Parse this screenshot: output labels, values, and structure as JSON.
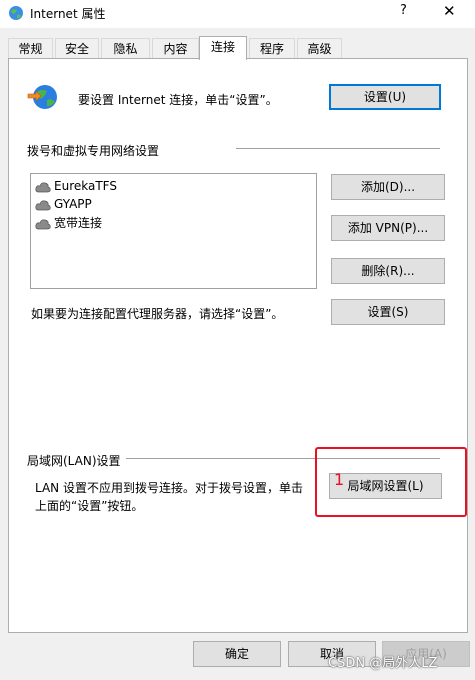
{
  "window": {
    "title": "Internet 属性",
    "help_label": "?",
    "close_label": "✕"
  },
  "tabs": [
    {
      "label": "常规"
    },
    {
      "label": "安全"
    },
    {
      "label": "隐私"
    },
    {
      "label": "内容"
    },
    {
      "label": "连接",
      "active": true
    },
    {
      "label": "程序"
    },
    {
      "label": "高级"
    }
  ],
  "setup": {
    "text": "要设置 Internet 连接，单击“设置”。",
    "button": "设置(U)"
  },
  "dialup": {
    "heading": "拨号和虚拟专用网络设置",
    "items": [
      {
        "label": "EurekaTFS"
      },
      {
        "label": "GYAPP"
      },
      {
        "label": "宽带连接"
      }
    ],
    "add_button": "添加(D)...",
    "add_vpn_button": "添加 VPN(P)...",
    "remove_button": "删除(R)...",
    "proxy_text": "如果要为连接配置代理服务器，请选择“设置”。",
    "settings_button": "设置(S)"
  },
  "lan": {
    "heading": "局域网(LAN)设置",
    "desc_line1": "LAN 设置不应用到拨号连接。对于拨号设置，单击",
    "desc_line2": "上面的“设置”按钮。",
    "button": "局域网设置(L)",
    "annotation_number": "1"
  },
  "footer": {
    "ok": "确定",
    "cancel": "取消",
    "apply": "应用(A)"
  },
  "watermark": "CSDN @局外人LZ",
  "colors": {
    "focus": "#0078d7",
    "annotation": "#e81123"
  }
}
